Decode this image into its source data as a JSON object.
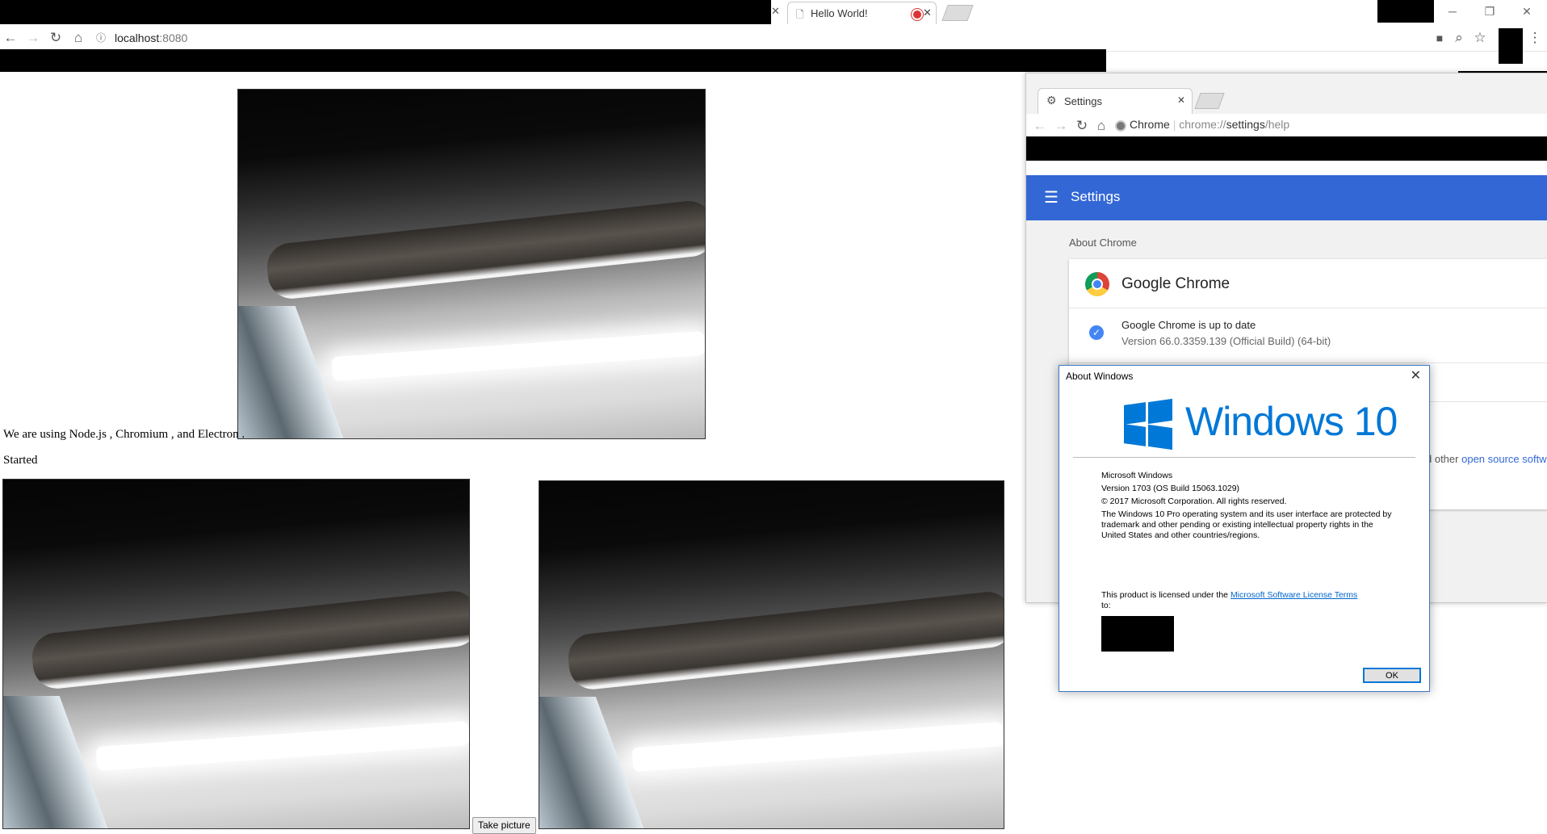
{
  "browser": {
    "tab_title": "Hello World!",
    "url_host": "localhost",
    "url_port": ":8080"
  },
  "page": {
    "tech_text": "We are using Node.js , Chromium , and Electron .",
    "status": "Started",
    "take_picture_label": "Take picture"
  },
  "settings_window": {
    "tab_title": "Settings",
    "url_origin": "Chrome",
    "url_scheme": "chrome://",
    "url_path_main": "settings",
    "url_path_rest": "/help",
    "header_title": "Settings",
    "section_label": "About Chrome",
    "product_name": "Google Chrome",
    "update_status": "Google Chrome is up to date",
    "version": "Version 66.0.3359.139 (Official Build) (64-bit)",
    "oss_prefix": "d other",
    "oss_link": "open source softw"
  },
  "winver": {
    "title": "About Windows",
    "brand": "Windows 10",
    "line1": "Microsoft Windows",
    "line2": "Version 1703 (OS Build 15063.1029)",
    "line3": "© 2017 Microsoft Corporation. All rights reserved.",
    "para": "The Windows 10 Pro operating system and its user interface are protected by trademark and other pending or existing intellectual property rights in the United States and other countries/regions.",
    "license_prefix": "This product is licensed under the",
    "license_link": "Microsoft Software License Terms",
    "license_suffix": "to:",
    "ok_label": "OK"
  },
  "colors": {
    "settings_header": "#3367d6",
    "windows_blue": "#0078d7"
  }
}
